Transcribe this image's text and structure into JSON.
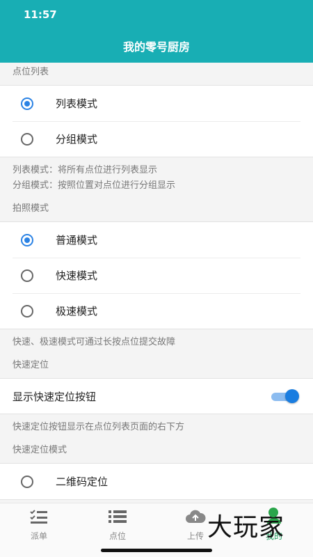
{
  "status": {
    "time": "11:57"
  },
  "header": {
    "title": "我的零号厨房"
  },
  "sections": {
    "point_list": {
      "title": "点位列表",
      "options": [
        "列表模式",
        "分组模式"
      ],
      "desc1": "列表模式：将所有点位进行列表显示",
      "desc2": "分组模式：按照位置对点位进行分组显示"
    },
    "photo_mode": {
      "title": "拍照模式",
      "options": [
        "普通模式",
        "快速模式",
        "极速模式"
      ],
      "desc": "快速、极速模式可通过长按点位提交故障"
    },
    "quick_locate": {
      "title": "快速定位",
      "toggle_label": "显示快速定位按钮",
      "toggle_on": true,
      "desc": "快速定位按钮显示在点位列表页面的右下方"
    },
    "quick_locate_mode": {
      "title": "快速定位模式",
      "options": [
        "二维码定位"
      ]
    }
  },
  "tabbar": {
    "tabs": [
      "派单",
      "点位",
      "上传",
      "我的"
    ],
    "active_tab": "我的",
    "icons": [
      "checklist-icon",
      "list-icon",
      "cloud-upload-icon",
      "person-icon"
    ]
  },
  "watermark": {
    "text": "大玩家"
  },
  "colors": {
    "header": "#18aeb4",
    "radio_selected": "#2a82e4",
    "toggle": "#1a7de0",
    "active_tab": "#1a9a5a"
  }
}
